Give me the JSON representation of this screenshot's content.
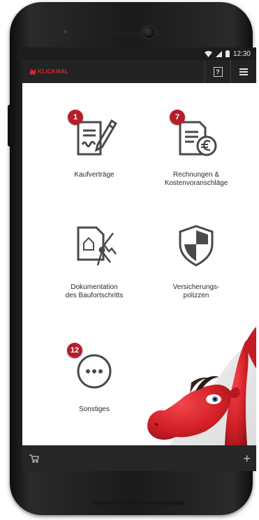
{
  "status_bar": {
    "time": "12:30",
    "icons": [
      "wifi-icon",
      "signal-icon",
      "battery-icon"
    ]
  },
  "app_bar": {
    "logo_text": "KLICKMAL",
    "help_label": "?",
    "menu_icon": "hamburger-icon"
  },
  "tiles": [
    {
      "id": "kaufvertraege",
      "label": "Kaufverträge",
      "badge": "1",
      "icon": "contract-icon"
    },
    {
      "id": "rechnungen",
      "label": "Rechnungen &\nKostenvoranschläge",
      "badge": "7",
      "icon": "invoice-euro-icon"
    },
    {
      "id": "dokumentation",
      "label": "Dokumentation\ndes Baufortschritts",
      "badge": "",
      "icon": "construction-document-icon"
    },
    {
      "id": "versicherung",
      "label": "Versicherungs-\npolizzen",
      "badge": "",
      "icon": "shield-icon"
    },
    {
      "id": "sonstiges",
      "label": "Sonstiges",
      "badge": "12",
      "icon": "more-icon"
    }
  ],
  "bottom_bar": {
    "left_icon": "cart-icon",
    "right_label": "+"
  },
  "colors": {
    "accent": "#b51f2a",
    "brand_red": "#d8242b",
    "bar_dark": "#232323",
    "icon_gray": "#4a4a4a"
  }
}
